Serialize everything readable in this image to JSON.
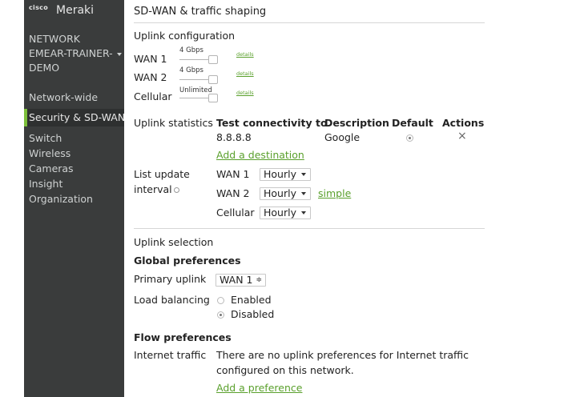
{
  "sidebar": {
    "brand_small": "cisco",
    "brand_name": "Meraki",
    "network_label_lines": [
      "NETWORK",
      "EMEAR-TRAINER-",
      "DEMO"
    ],
    "items": [
      {
        "label": "Network-wide",
        "selected": false
      },
      {
        "label": "Security & SD-WAN",
        "selected": true
      },
      {
        "label": "Switch",
        "selected": false
      },
      {
        "label": "Wireless",
        "selected": false
      },
      {
        "label": "Cameras",
        "selected": false
      },
      {
        "label": "Insight",
        "selected": false
      },
      {
        "label": "Organization",
        "selected": false
      }
    ]
  },
  "page_title": "SD-WAN & traffic shaping",
  "uplink_config": {
    "heading": "Uplink configuration",
    "rows": [
      {
        "name": "WAN 1",
        "limit": "4 Gbps",
        "link": "details"
      },
      {
        "name": "WAN 2",
        "limit": "4 Gbps",
        "link": "details"
      },
      {
        "name": "Cellular",
        "limit": "Unlimited",
        "link": "details"
      }
    ]
  },
  "uplink_stats": {
    "label": "Uplink statistics",
    "columns": [
      "Test connectivity to",
      "Description",
      "Default",
      "Actions"
    ],
    "rows": [
      {
        "target": "8.8.8.8",
        "description": "Google",
        "action_icon": "×"
      }
    ],
    "add_destination": "Add a destination"
  },
  "list_update": {
    "label_line1": "List update",
    "label_line2": "interval",
    "rows": [
      {
        "name": "WAN 1",
        "value": "Hourly"
      },
      {
        "name": "WAN 2",
        "value": "Hourly"
      },
      {
        "name": "Cellular",
        "value": "Hourly"
      }
    ],
    "simple_link": "simple"
  },
  "uplink_selection": {
    "heading": "Uplink selection",
    "global_heading": "Global preferences",
    "primary_label": "Primary uplink",
    "primary_value": "WAN 1",
    "load_balancing_label": "Load balancing",
    "options": [
      {
        "label": "Enabled",
        "selected": false
      },
      {
        "label": "Disabled",
        "selected": true
      }
    ]
  },
  "flow_prefs": {
    "heading": "Flow preferences",
    "internet_label": "Internet traffic",
    "message_line1": "There are no uplink preferences for Internet traffic",
    "message_line2": "configured on this network.",
    "add_preference": "Add a preference"
  }
}
